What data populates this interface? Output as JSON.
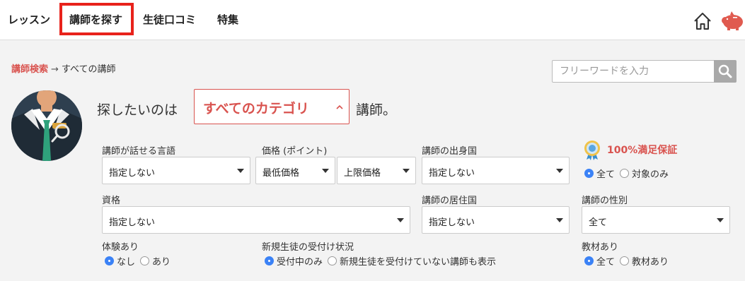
{
  "nav": {
    "items": [
      "レッスン",
      "講師を探す",
      "生徒口コミ",
      "特集"
    ]
  },
  "breadcrumb": {
    "link": "講師検索",
    "separator": "→",
    "current": "すべての講師"
  },
  "search": {
    "placeholder": "フリーワードを入力",
    "value": ""
  },
  "lead": {
    "prefix": "探したいのは",
    "category": "すべてのカテゴリ",
    "suffix": "講師。"
  },
  "filters": {
    "language": {
      "label": "講師が話せる言語",
      "value": "指定しない"
    },
    "price": {
      "label": "価格 (ポイント)",
      "min": "最低価格",
      "max": "上限価格"
    },
    "origin": {
      "label": "講師の出身国",
      "value": "指定しない"
    },
    "guarantee": {
      "label": "100%満足保証",
      "options": [
        "全て",
        "対象のみ"
      ],
      "selected": "全て"
    },
    "qualification": {
      "label": "資格",
      "value": "指定しない"
    },
    "residence": {
      "label": "講師の居住国",
      "value": "指定しない"
    },
    "gender": {
      "label": "講師の性別",
      "value": "全て"
    },
    "trial": {
      "label": "体験あり",
      "options": [
        "なし",
        "あり"
      ],
      "selected": "なし"
    },
    "new_students": {
      "label": "新規生徒の受付け状況",
      "options": [
        "受付中のみ",
        "新規生徒を受付けていない講師も表示"
      ],
      "selected": "受付中のみ"
    },
    "materials": {
      "label": "教材あり",
      "options": [
        "全て",
        "教材あり"
      ],
      "selected": "全て"
    }
  },
  "colors": {
    "accent": "#d9534f",
    "highlight_box": "#e8221b",
    "radio_on": "#3b82f6"
  }
}
